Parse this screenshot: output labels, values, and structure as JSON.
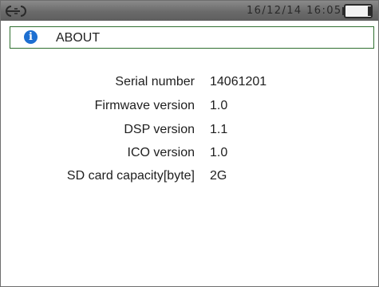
{
  "status_bar": {
    "datetime": "16/12/14 16:05",
    "icons": [
      "plug-icon",
      "battery-icon"
    ]
  },
  "header": {
    "icon": "info-icon",
    "icon_glyph": "i",
    "title": "ABOUT",
    "accent_color": "#2f6f2f",
    "icon_color": "#1d6fd1"
  },
  "info": {
    "rows": [
      {
        "label": "Serial number",
        "value": "14061201"
      },
      {
        "label": "Firmwave version",
        "value": "1.0"
      },
      {
        "label": "DSP version",
        "value": "1.1"
      },
      {
        "label": "ICO version",
        "value": "1.0"
      },
      {
        "label": "SD card capacity[byte]",
        "value": "2G"
      }
    ]
  }
}
